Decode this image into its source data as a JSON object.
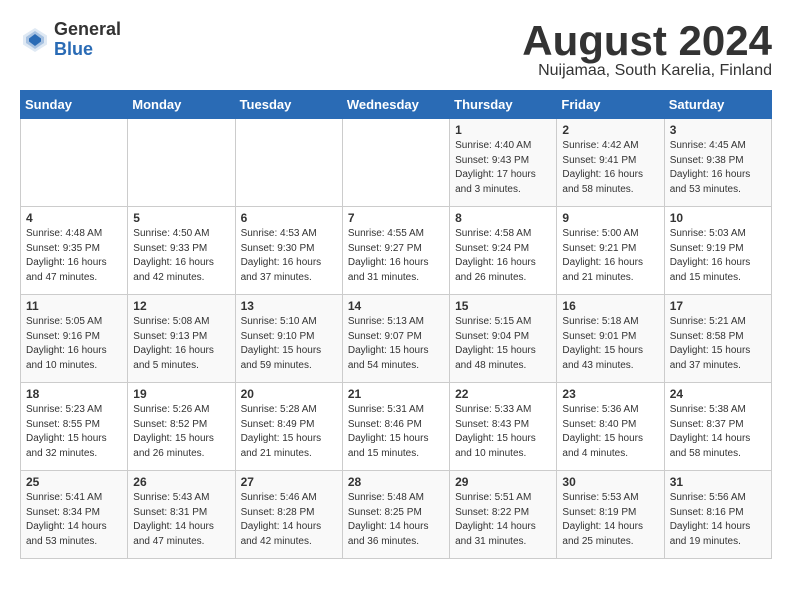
{
  "header": {
    "logo_general": "General",
    "logo_blue": "Blue",
    "month_title": "August 2024",
    "subtitle": "Nuijamaa, South Karelia, Finland"
  },
  "weekdays": [
    "Sunday",
    "Monday",
    "Tuesday",
    "Wednesday",
    "Thursday",
    "Friday",
    "Saturday"
  ],
  "weeks": [
    [
      {
        "day": "",
        "info": ""
      },
      {
        "day": "",
        "info": ""
      },
      {
        "day": "",
        "info": ""
      },
      {
        "day": "",
        "info": ""
      },
      {
        "day": "1",
        "info": "Sunrise: 4:40 AM\nSunset: 9:43 PM\nDaylight: 17 hours\nand 3 minutes."
      },
      {
        "day": "2",
        "info": "Sunrise: 4:42 AM\nSunset: 9:41 PM\nDaylight: 16 hours\nand 58 minutes."
      },
      {
        "day": "3",
        "info": "Sunrise: 4:45 AM\nSunset: 9:38 PM\nDaylight: 16 hours\nand 53 minutes."
      }
    ],
    [
      {
        "day": "4",
        "info": "Sunrise: 4:48 AM\nSunset: 9:35 PM\nDaylight: 16 hours\nand 47 minutes."
      },
      {
        "day": "5",
        "info": "Sunrise: 4:50 AM\nSunset: 9:33 PM\nDaylight: 16 hours\nand 42 minutes."
      },
      {
        "day": "6",
        "info": "Sunrise: 4:53 AM\nSunset: 9:30 PM\nDaylight: 16 hours\nand 37 minutes."
      },
      {
        "day": "7",
        "info": "Sunrise: 4:55 AM\nSunset: 9:27 PM\nDaylight: 16 hours\nand 31 minutes."
      },
      {
        "day": "8",
        "info": "Sunrise: 4:58 AM\nSunset: 9:24 PM\nDaylight: 16 hours\nand 26 minutes."
      },
      {
        "day": "9",
        "info": "Sunrise: 5:00 AM\nSunset: 9:21 PM\nDaylight: 16 hours\nand 21 minutes."
      },
      {
        "day": "10",
        "info": "Sunrise: 5:03 AM\nSunset: 9:19 PM\nDaylight: 16 hours\nand 15 minutes."
      }
    ],
    [
      {
        "day": "11",
        "info": "Sunrise: 5:05 AM\nSunset: 9:16 PM\nDaylight: 16 hours\nand 10 minutes."
      },
      {
        "day": "12",
        "info": "Sunrise: 5:08 AM\nSunset: 9:13 PM\nDaylight: 16 hours\nand 5 minutes."
      },
      {
        "day": "13",
        "info": "Sunrise: 5:10 AM\nSunset: 9:10 PM\nDaylight: 15 hours\nand 59 minutes."
      },
      {
        "day": "14",
        "info": "Sunrise: 5:13 AM\nSunset: 9:07 PM\nDaylight: 15 hours\nand 54 minutes."
      },
      {
        "day": "15",
        "info": "Sunrise: 5:15 AM\nSunset: 9:04 PM\nDaylight: 15 hours\nand 48 minutes."
      },
      {
        "day": "16",
        "info": "Sunrise: 5:18 AM\nSunset: 9:01 PM\nDaylight: 15 hours\nand 43 minutes."
      },
      {
        "day": "17",
        "info": "Sunrise: 5:21 AM\nSunset: 8:58 PM\nDaylight: 15 hours\nand 37 minutes."
      }
    ],
    [
      {
        "day": "18",
        "info": "Sunrise: 5:23 AM\nSunset: 8:55 PM\nDaylight: 15 hours\nand 32 minutes."
      },
      {
        "day": "19",
        "info": "Sunrise: 5:26 AM\nSunset: 8:52 PM\nDaylight: 15 hours\nand 26 minutes."
      },
      {
        "day": "20",
        "info": "Sunrise: 5:28 AM\nSunset: 8:49 PM\nDaylight: 15 hours\nand 21 minutes."
      },
      {
        "day": "21",
        "info": "Sunrise: 5:31 AM\nSunset: 8:46 PM\nDaylight: 15 hours\nand 15 minutes."
      },
      {
        "day": "22",
        "info": "Sunrise: 5:33 AM\nSunset: 8:43 PM\nDaylight: 15 hours\nand 10 minutes."
      },
      {
        "day": "23",
        "info": "Sunrise: 5:36 AM\nSunset: 8:40 PM\nDaylight: 15 hours\nand 4 minutes."
      },
      {
        "day": "24",
        "info": "Sunrise: 5:38 AM\nSunset: 8:37 PM\nDaylight: 14 hours\nand 58 minutes."
      }
    ],
    [
      {
        "day": "25",
        "info": "Sunrise: 5:41 AM\nSunset: 8:34 PM\nDaylight: 14 hours\nand 53 minutes."
      },
      {
        "day": "26",
        "info": "Sunrise: 5:43 AM\nSunset: 8:31 PM\nDaylight: 14 hours\nand 47 minutes."
      },
      {
        "day": "27",
        "info": "Sunrise: 5:46 AM\nSunset: 8:28 PM\nDaylight: 14 hours\nand 42 minutes."
      },
      {
        "day": "28",
        "info": "Sunrise: 5:48 AM\nSunset: 8:25 PM\nDaylight: 14 hours\nand 36 minutes."
      },
      {
        "day": "29",
        "info": "Sunrise: 5:51 AM\nSunset: 8:22 PM\nDaylight: 14 hours\nand 31 minutes."
      },
      {
        "day": "30",
        "info": "Sunrise: 5:53 AM\nSunset: 8:19 PM\nDaylight: 14 hours\nand 25 minutes."
      },
      {
        "day": "31",
        "info": "Sunrise: 5:56 AM\nSunset: 8:16 PM\nDaylight: 14 hours\nand 19 minutes."
      }
    ]
  ]
}
